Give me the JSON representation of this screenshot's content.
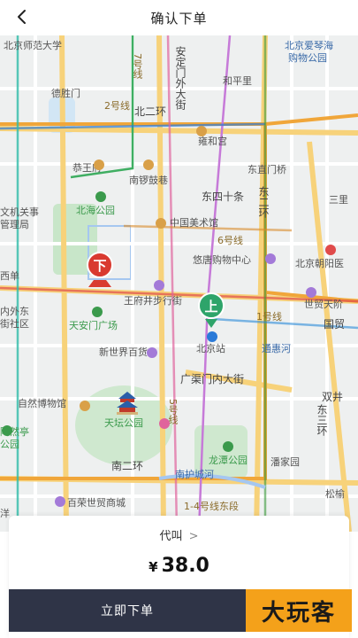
{
  "header": {
    "title": "确认下单",
    "back_icon": "chevron-left-icon"
  },
  "map": {
    "labels": {
      "bnu": "北京师范大学",
      "anding_street": "安定门外大街",
      "amanda": "北京爱琴海",
      "amanda2": "购物公园",
      "hepingli": "和平里",
      "deshengmen": "德胜门",
      "line2": "2号线",
      "erhuan_north": "北二环",
      "yonghegong": "雍和宫",
      "dongzhimen": "东直门桥",
      "gongwangfu": "恭王府",
      "nanluoguxiang": "南锣鼓巷",
      "dongsishitiao": "东四十条",
      "sanli": "三里",
      "wenguan": "文机关事",
      "guanliju": "管理局",
      "beihai": "北海公园",
      "art_museum": "中国美术馆",
      "line6": "6号线",
      "dong_huan": "东二环",
      "chaoyang_hosp": "北京朝阳医",
      "youtang": "悠唐购物中心",
      "xidan": "西单",
      "wangfujing": "王府井步行街",
      "line1": "1号线",
      "tiananmen": "天安门广场",
      "yangkou": "内外东",
      "jiequ": "街社区",
      "bjstation": "北京站",
      "tongda": "通惠河",
      "shimao": "世贸天阶",
      "guomao": "国贸",
      "xinshijie": "新世界百货",
      "guangqumen": "广渠门内大街",
      "ziran_museum": "自然博物馆",
      "tiantan": "天坛公园",
      "shuangjing": "双井",
      "taoranting": "陶然亭",
      "park2": "公园",
      "longtan": "龙潭公园",
      "panjiayuan": "潘家园",
      "nanerhuan": "南二环",
      "hucheng": "南护城河",
      "line14": "1-4号线东段",
      "baironghs": "百荣世贸商城",
      "songyu": "松榆",
      "yang": "洋",
      "line5": "5号线",
      "line7": "7号线",
      "dong3": "东三环"
    }
  },
  "markers": {
    "dropoff": "下",
    "pickup": "上"
  },
  "panel": {
    "proxy_label": "代叫",
    "proxy_chevron": ">",
    "currency": "¥",
    "price": "38.0"
  },
  "order_button": {
    "label": "立即下单"
  },
  "watermark": {
    "text": "大玩客"
  },
  "colors": {
    "accent_dark": "#2f3447",
    "dropoff_red": "#d93a30",
    "pickup_green": "#2ea46a",
    "watermark_orange": "#f4a11a"
  }
}
